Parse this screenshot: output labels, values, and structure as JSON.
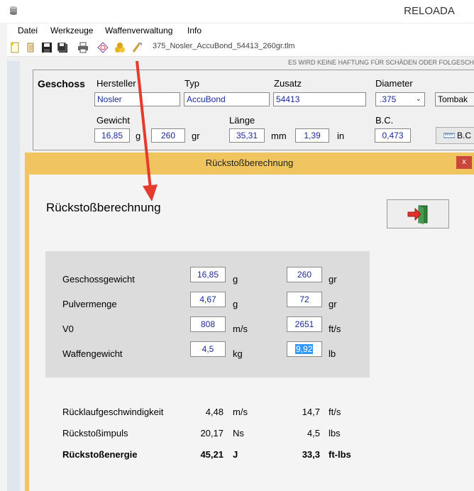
{
  "app": {
    "title": "RELOADA"
  },
  "menu": [
    "Datei",
    "Werkzeuge",
    "Waffenverwaltung",
    "Info"
  ],
  "toolbar": {
    "filename": "375_Nosler_AccuBond_54413_260gr.tlm"
  },
  "disclaimer": "ES WIRD KEINE HAFTUNG FÜR SCHÄDEN ODER FOLGESCH",
  "projectile": {
    "section_label": "Geschoss",
    "manufacturer_label": "Hersteller",
    "manufacturer": "Nosler",
    "type_label": "Typ",
    "type": "AccuBond",
    "addition_label": "Zusatz",
    "addition": "54413",
    "diameter_label": "Diameter",
    "diameter": ".375",
    "material": "Tombak",
    "weight_label": "Gewicht",
    "weight_g": "16,85",
    "unit_g": "g",
    "weight_gr": "260",
    "unit_gr": "gr",
    "length_label": "Länge",
    "length_mm": "35,31",
    "unit_mm": "mm",
    "length_in": "1,39",
    "unit_in": "in",
    "bc_label": "B.C.",
    "bc": "0,473",
    "bc_button": "B.C"
  },
  "dialog": {
    "title": "Rückstoßberechnung",
    "close": "x",
    "heading": "Rückstoßberechnung",
    "inputs": [
      {
        "label": "Geschossgewicht",
        "metric": "16,85",
        "metric_unit": "g",
        "imperial": "260",
        "imperial_unit": "gr"
      },
      {
        "label": "Pulvermenge",
        "metric": "4,67",
        "metric_unit": "g",
        "imperial": "72",
        "imperial_unit": "gr"
      },
      {
        "label": "V0",
        "metric": "808",
        "metric_unit": "m/s",
        "imperial": "2651",
        "imperial_unit": "ft/s"
      },
      {
        "label": "Waffengewicht",
        "metric": "4,5",
        "metric_unit": "kg",
        "imperial": "9,92",
        "imperial_unit": "lb"
      }
    ],
    "results": [
      {
        "label": "Rücklaufgeschwindigkeit",
        "metric": "4,48",
        "metric_unit": "m/s",
        "imperial": "14,7",
        "imperial_unit": "ft/s"
      },
      {
        "label": "Rückstoßimpuls",
        "metric": "20,17",
        "metric_unit": "Ns",
        "imperial": "4,5",
        "imperial_unit": "lbs"
      },
      {
        "label": "Rückstoßenergie",
        "metric": "45,21",
        "metric_unit": "J",
        "imperial": "33,3",
        "imperial_unit": "ft-lbs"
      }
    ]
  },
  "colors": {
    "dialog_frame": "#f0c560",
    "arrow": "#e53a2e",
    "selection": "#3399ff",
    "value_text": "#1a2a9a"
  }
}
